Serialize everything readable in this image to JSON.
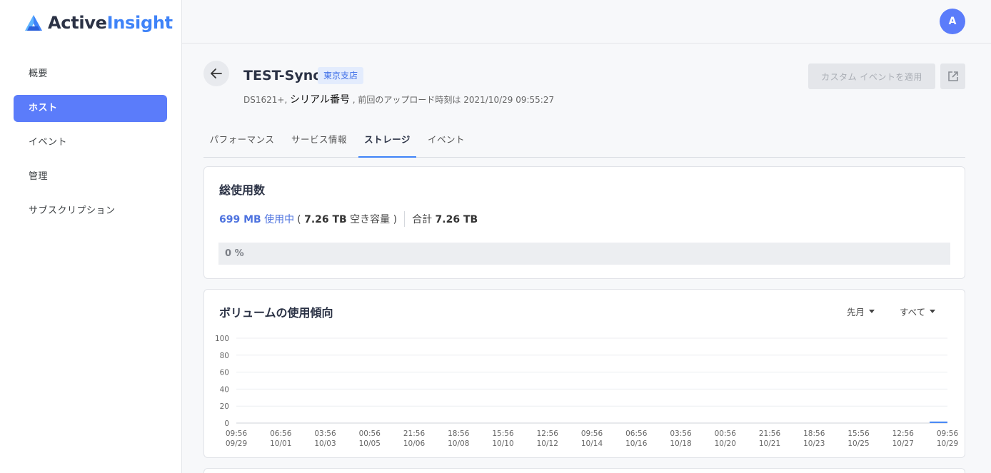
{
  "brand": {
    "name_part1": "Active",
    "name_part2": "Insight"
  },
  "sidebar": {
    "items": [
      {
        "label": "概要",
        "active": false
      },
      {
        "label": "ホスト",
        "active": true
      },
      {
        "label": "イベント",
        "active": false
      },
      {
        "label": "管理",
        "active": false
      },
      {
        "label": "サブスクリプション",
        "active": false
      }
    ]
  },
  "header": {
    "avatar_initial": "A"
  },
  "host": {
    "name": "TEST-Syno",
    "tag": "東京支店",
    "model": "DS1621+,",
    "serial_label": "シリアル番号",
    "upload_text": ", 前回のアップロード時刻は 2021/10/29 09:55:27"
  },
  "actions": {
    "custom_event_label": "カスタム イベントを適用",
    "external_link_icon": "external-link-icon"
  },
  "tabs": [
    {
      "label": "パフォーマンス",
      "active": false
    },
    {
      "label": "サービス情報",
      "active": false
    },
    {
      "label": "ストレージ",
      "active": true
    },
    {
      "label": "イベント",
      "active": false
    }
  ],
  "total_usage": {
    "title": "総使用数",
    "used_value": "699 MB",
    "used_label": "使用中",
    "paren_open": "(",
    "free_value": "7.26 TB",
    "free_label": "空き容量",
    "paren_close": ")",
    "total_label": "合計",
    "total_value": "7.26 TB",
    "percent_text": "0 %",
    "percent": 0
  },
  "trend": {
    "title": "ボリュームの使用傾向",
    "period_dropdown": "先月",
    "filter_dropdown": "すべて"
  },
  "colors": {
    "accent": "#5b7cfa",
    "series": "#3f83f8"
  },
  "chart_data": {
    "type": "line",
    "title": "ボリュームの使用傾向",
    "xlabel": "",
    "ylabel": "",
    "ylim": [
      0,
      100
    ],
    "yticks": [
      0,
      20,
      40,
      60,
      80,
      100
    ],
    "grid": true,
    "x_ticks": [
      [
        "09:56",
        "09/29"
      ],
      [
        "06:56",
        "10/01"
      ],
      [
        "03:56",
        "10/03"
      ],
      [
        "00:56",
        "10/05"
      ],
      [
        "21:56",
        "10/06"
      ],
      [
        "18:56",
        "10/08"
      ],
      [
        "15:56",
        "10/10"
      ],
      [
        "12:56",
        "10/12"
      ],
      [
        "09:56",
        "10/14"
      ],
      [
        "06:56",
        "10/16"
      ],
      [
        "03:56",
        "10/18"
      ],
      [
        "00:56",
        "10/20"
      ],
      [
        "21:56",
        "10/21"
      ],
      [
        "18:56",
        "10/23"
      ],
      [
        "15:56",
        "10/25"
      ],
      [
        "12:56",
        "10/27"
      ],
      [
        "09:56",
        "10/29"
      ]
    ],
    "series": [
      {
        "x_start_tick": 15.6,
        "x_end_tick": 16,
        "values": [
          0.1,
          0.1
        ]
      }
    ]
  }
}
